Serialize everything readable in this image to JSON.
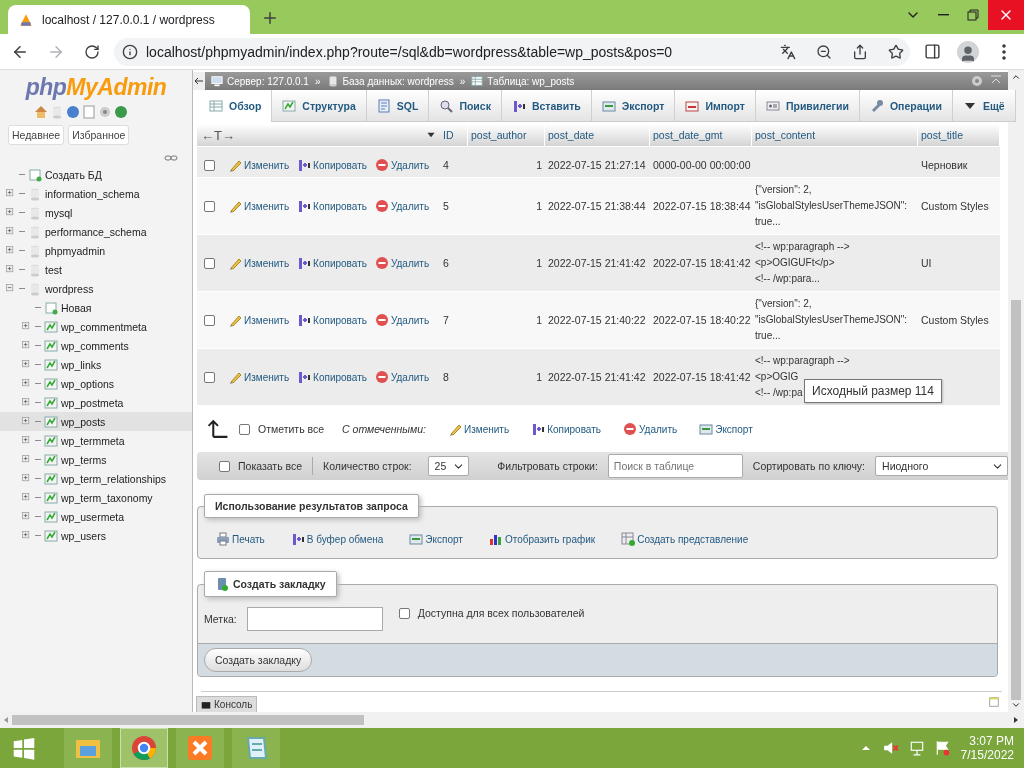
{
  "browser": {
    "tab_title": "localhost / 127.0.0.1 / wordpress",
    "url": "localhost/phpmyadmin/index.php?route=/sql&db=wordpress&table=wp_posts&pos=0"
  },
  "sidebar": {
    "logo": [
      "php",
      "MyAdmin"
    ],
    "tabs": [
      "Недавнее",
      "Избранное"
    ],
    "tree": [
      {
        "label": "Создать БД",
        "kind": "new",
        "selected": false
      },
      {
        "label": "information_schema",
        "kind": "db",
        "expanded": false,
        "selected": false
      },
      {
        "label": "mysql",
        "kind": "db",
        "expanded": false,
        "selected": false
      },
      {
        "label": "performance_schema",
        "kind": "db",
        "expanded": false,
        "selected": false
      },
      {
        "label": "phpmyadmin",
        "kind": "db",
        "expanded": false,
        "selected": false
      },
      {
        "label": "test",
        "kind": "db",
        "expanded": false,
        "selected": false
      },
      {
        "label": "wordpress",
        "kind": "db",
        "expanded": true,
        "selected": false,
        "children": [
          {
            "label": "Новая",
            "kind": "new",
            "selected": false
          },
          {
            "label": "wp_commentmeta",
            "kind": "table",
            "expanded": false,
            "selected": false
          },
          {
            "label": "wp_comments",
            "kind": "table",
            "expanded": false,
            "selected": false
          },
          {
            "label": "wp_links",
            "kind": "table",
            "expanded": false,
            "selected": false
          },
          {
            "label": "wp_options",
            "kind": "table",
            "expanded": false,
            "selected": false
          },
          {
            "label": "wp_postmeta",
            "kind": "table",
            "expanded": false,
            "selected": false
          },
          {
            "label": "wp_posts",
            "kind": "table",
            "expanded": false,
            "selected": true
          },
          {
            "label": "wp_termmeta",
            "kind": "table",
            "expanded": false,
            "selected": false
          },
          {
            "label": "wp_terms",
            "kind": "table",
            "expanded": false,
            "selected": false
          },
          {
            "label": "wp_term_relationships",
            "kind": "table",
            "expanded": false,
            "selected": false
          },
          {
            "label": "wp_term_taxonomy",
            "kind": "table",
            "expanded": false,
            "selected": false
          },
          {
            "label": "wp_usermeta",
            "kind": "table",
            "expanded": false,
            "selected": false
          },
          {
            "label": "wp_users",
            "kind": "table",
            "expanded": false,
            "selected": false
          }
        ]
      }
    ]
  },
  "breadcrumb": {
    "items": [
      "Сервер: 127.0.0.1",
      "База данных: wordpress",
      "Таблица: wp_posts"
    ],
    "separators": [
      "»",
      "»"
    ]
  },
  "tabs": [
    {
      "label": "Обзор",
      "selected": true
    },
    {
      "label": "Структура",
      "selected": false
    },
    {
      "label": "SQL",
      "selected": false
    },
    {
      "label": "Поиск",
      "selected": false
    },
    {
      "label": "Вставить",
      "selected": false
    },
    {
      "label": "Экспорт",
      "selected": false
    },
    {
      "label": "Импорт",
      "selected": false
    },
    {
      "label": "Привилегии",
      "selected": false
    },
    {
      "label": "Операции",
      "selected": false
    },
    {
      "label": "Ещё",
      "selected": false
    }
  ],
  "table": {
    "resize_label": "←T→",
    "columns": [
      "ID",
      "post_author",
      "post_date",
      "post_date_gmt",
      "post_content",
      "post_title"
    ],
    "rows": [
      {
        "checked": false,
        "actions": [
          "Изменить",
          "Копировать",
          "Удалить"
        ],
        "id": "4",
        "author": "1",
        "post_date": "2022-07-15 21:27:14",
        "post_date_gmt": "0000-00-00 00:00:00",
        "post_title": "Черновик"
      },
      {
        "checked": false,
        "actions": [
          "Изменить",
          "Копировать",
          "Удалить"
        ],
        "id": "5",
        "author": "1",
        "post_date": "2022-07-15 21:38:44",
        "post_date_gmt": "2022-07-15 18:38:44",
        "post_content": [
          "{\"version\": 2,",
          "\"isGlobalStylesUserThemeJSON\":",
          "true..."
        ],
        "post_title": "Custom Styles"
      },
      {
        "checked": false,
        "actions": [
          "Изменить",
          "Копировать",
          "Удалить"
        ],
        "id": "6",
        "author": "1",
        "post_date": "2022-07-15 21:41:42",
        "post_date_gmt": "2022-07-15 18:41:42",
        "post_content": [
          "<!-- wp:paragraph -->",
          "<p>OGIGUFt</p>",
          "<!-- /wp:para..."
        ],
        "post_title": "UI"
      },
      {
        "checked": false,
        "actions": [
          "Изменить",
          "Копировать",
          "Удалить"
        ],
        "id": "7",
        "author": "1",
        "post_date": "2022-07-15 21:40:22",
        "post_date_gmt": "2022-07-15 18:40:22",
        "post_content": [
          "{\"version\": 2,",
          "\"isGlobalStylesUserThemeJSON\":",
          "true..."
        ],
        "post_title": "Custom Styles"
      },
      {
        "checked": false,
        "actions": [
          "Изменить",
          "Копировать",
          "Удалить"
        ],
        "id": "8",
        "author": "1",
        "post_date": "2022-07-15 21:41:42",
        "post_date_gmt": "2022-07-15 18:41:42",
        "post_content": [
          "<!-- wp:paragraph -->",
          "<p>OGIG",
          "<!-- /wp:pa"
        ]
      }
    ],
    "tooltip": "Исходный размер 114"
  },
  "bulk": {
    "check_all": {
      "label": "Отметить все",
      "checked": false
    },
    "with_selected": "С отмеченными:",
    "actions": [
      "Изменить",
      "Копировать",
      "Удалить",
      "Экспорт"
    ]
  },
  "navigation": {
    "show_all": {
      "label": "Показать все",
      "checked": false
    },
    "rows_label": "Количество строк:",
    "rows_value": "25",
    "filter_label": "Фильтровать строки:",
    "filter_placeholder": "Поиск в таблице",
    "sort_label": "Сортировать по ключу:",
    "sort_value": "Ниодного"
  },
  "query_ops": {
    "legend": "Использование результатов запроса",
    "items": [
      "Печать",
      "В буфер обмена",
      "Экспорт",
      "Отобразить график",
      "Создать представление"
    ]
  },
  "bookmark": {
    "legend": "Создать закладку",
    "label": "Метка:",
    "public": {
      "label": "Доступна для всех пользователей",
      "checked": false
    },
    "button": "Создать закладку"
  },
  "console": "Консоль",
  "taskbar": {
    "apps": [
      {
        "selected": false
      },
      {
        "selected": true
      },
      {
        "selected": false
      },
      {
        "selected": false
      }
    ],
    "time": "3:07 PM",
    "date": "7/15/2022"
  }
}
